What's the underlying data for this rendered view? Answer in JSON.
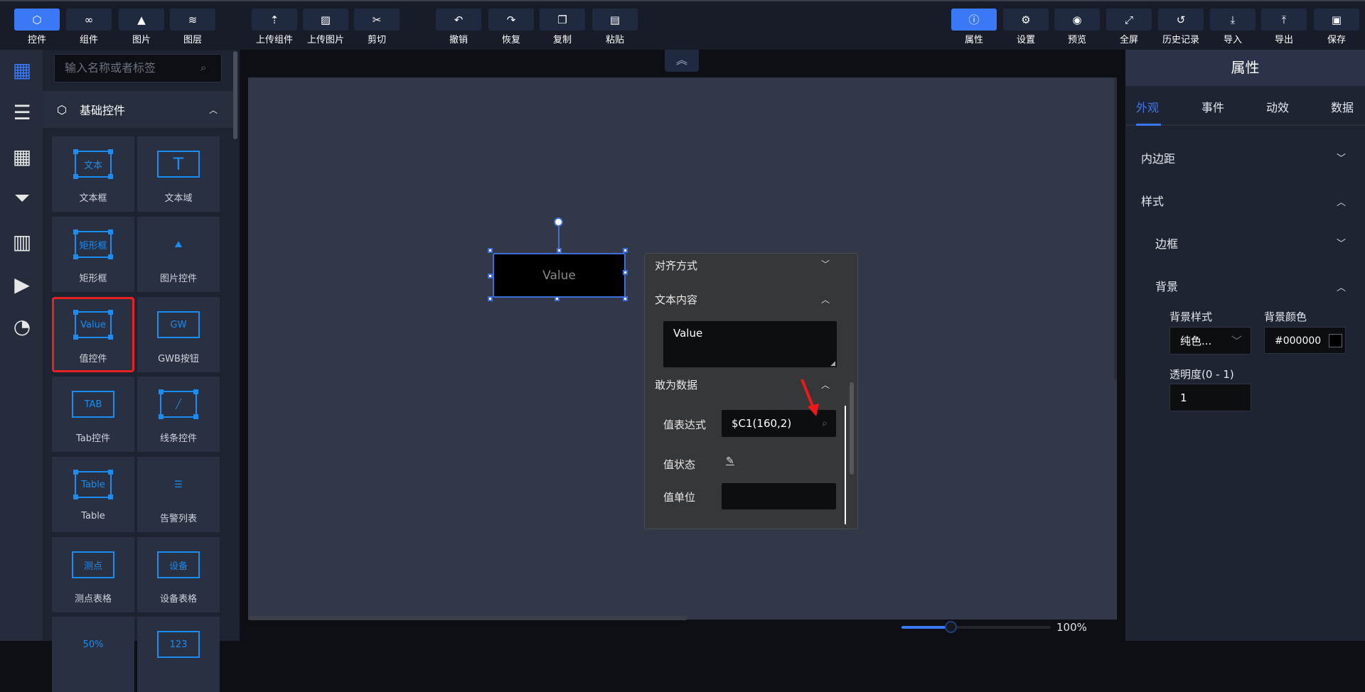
{
  "toolbar": {
    "left": [
      {
        "label": "控件",
        "icon": "cube-icon",
        "glyph": "⬡",
        "active": true
      },
      {
        "label": "组件",
        "icon": "link-icon",
        "glyph": "∞"
      },
      {
        "label": "图片",
        "icon": "image-icon",
        "glyph": "▲"
      },
      {
        "label": "图层",
        "icon": "layers-icon",
        "glyph": "≋"
      },
      {
        "label": "上传组件",
        "icon": "upload-component-icon",
        "glyph": "⇡"
      },
      {
        "label": "上传图片",
        "icon": "upload-image-icon",
        "glyph": "▨"
      },
      {
        "label": "剪切",
        "icon": "cut-icon",
        "glyph": "✂"
      },
      {
        "label": "撤销",
        "icon": "undo-icon",
        "glyph": "↶"
      },
      {
        "label": "恢复",
        "icon": "redo-icon",
        "glyph": "↷"
      },
      {
        "label": "复制",
        "icon": "copy-icon",
        "glyph": "❐"
      },
      {
        "label": "粘贴",
        "icon": "paste-icon",
        "glyph": "▤"
      }
    ],
    "right": [
      {
        "label": "属性",
        "icon": "info-icon",
        "glyph": "ⓘ",
        "active": true
      },
      {
        "label": "设置",
        "icon": "gear-icon",
        "glyph": "⚙"
      },
      {
        "label": "预览",
        "icon": "eye-icon",
        "glyph": "◉"
      },
      {
        "label": "全屏",
        "icon": "fullscreen-icon",
        "glyph": "⤢"
      },
      {
        "label": "历史记录",
        "icon": "history-icon",
        "glyph": "↺"
      },
      {
        "label": "导入",
        "icon": "import-icon",
        "glyph": "⤓"
      },
      {
        "label": "导出",
        "icon": "export-icon",
        "glyph": "⤒"
      },
      {
        "label": "保存",
        "icon": "save-icon",
        "glyph": "▣"
      }
    ]
  },
  "sidebar_icons": [
    "grid-icon",
    "sliders-icon",
    "table-icon",
    "filter-list-icon",
    "bar-chart-icon",
    "video-icon",
    "pie-chart-icon"
  ],
  "left_panel": {
    "search_placeholder": "输入名称或者标签",
    "section_title": "基础控件",
    "items": [
      {
        "label": "文本框",
        "icon": "text-box-icon",
        "icon_text": "文本",
        "kind": "box"
      },
      {
        "label": "文本域",
        "icon": "text-area-icon",
        "icon_text": "T",
        "kind": "plain"
      },
      {
        "label": "矩形框",
        "icon": "rectangle-icon",
        "icon_text": "矩形框",
        "kind": "box"
      },
      {
        "label": "图片控件",
        "icon": "image-control-icon",
        "icon_text": "⛰",
        "kind": "plain"
      },
      {
        "label": "值控件",
        "icon": "value-control-icon",
        "icon_text": "Value",
        "kind": "box",
        "selected": true
      },
      {
        "label": "GWB按钮",
        "icon": "gwb-button-icon",
        "icon_text": "GW",
        "kind": "plain"
      },
      {
        "label": "Tab控件",
        "icon": "tab-control-icon",
        "icon_text": "TAB",
        "kind": "plain"
      },
      {
        "label": "线条控件",
        "icon": "line-control-icon",
        "icon_text": "╱",
        "kind": "box"
      },
      {
        "label": "Table",
        "icon": "table-control-icon",
        "icon_text": "Table",
        "kind": "box"
      },
      {
        "label": "告警列表",
        "icon": "alarm-list-icon",
        "icon_text": "☰",
        "kind": "plain"
      },
      {
        "label": "测点表格",
        "icon": "point-table-icon",
        "icon_text": "测点",
        "kind": "plain"
      },
      {
        "label": "设备表格",
        "icon": "device-table-icon",
        "icon_text": "设备",
        "kind": "plain"
      },
      {
        "label": "",
        "icon": "percent-icon",
        "icon_text": "50%",
        "kind": "plain"
      },
      {
        "label": "",
        "icon": "number-icon",
        "icon_text": "123",
        "kind": "plain"
      }
    ]
  },
  "canvas": {
    "widget_text": "Value",
    "zoom": {
      "value_percent": 100,
      "label": "100%",
      "slider_fraction": 0.33
    }
  },
  "popup": {
    "align_label": "对齐方式",
    "text_content_label": "文本内容",
    "text_content_value": "Value",
    "data_section_label": "敢为数据",
    "expr_label": "值表达式",
    "expr_value": "$C1(160,2)",
    "state_label": "值状态",
    "unit_label": "值单位",
    "unit_value": ""
  },
  "right_panel": {
    "title": "属性",
    "tabs": [
      "外观",
      "事件",
      "动效",
      "数据"
    ],
    "active_tab": 0,
    "padding_label": "内边距",
    "style_label": "样式",
    "border_label": "边框",
    "background_label": "背景",
    "bg_style_label": "背景样式",
    "bg_style_value": "纯色...",
    "bg_color_label": "背景颜色",
    "bg_color_value": "#000000",
    "opacity_label": "透明度(0 - 1)",
    "opacity_value": "1"
  },
  "colors": {
    "accent": "#3a78f5",
    "icon_blue": "#1b8cf0",
    "highlight": "#e82222"
  }
}
